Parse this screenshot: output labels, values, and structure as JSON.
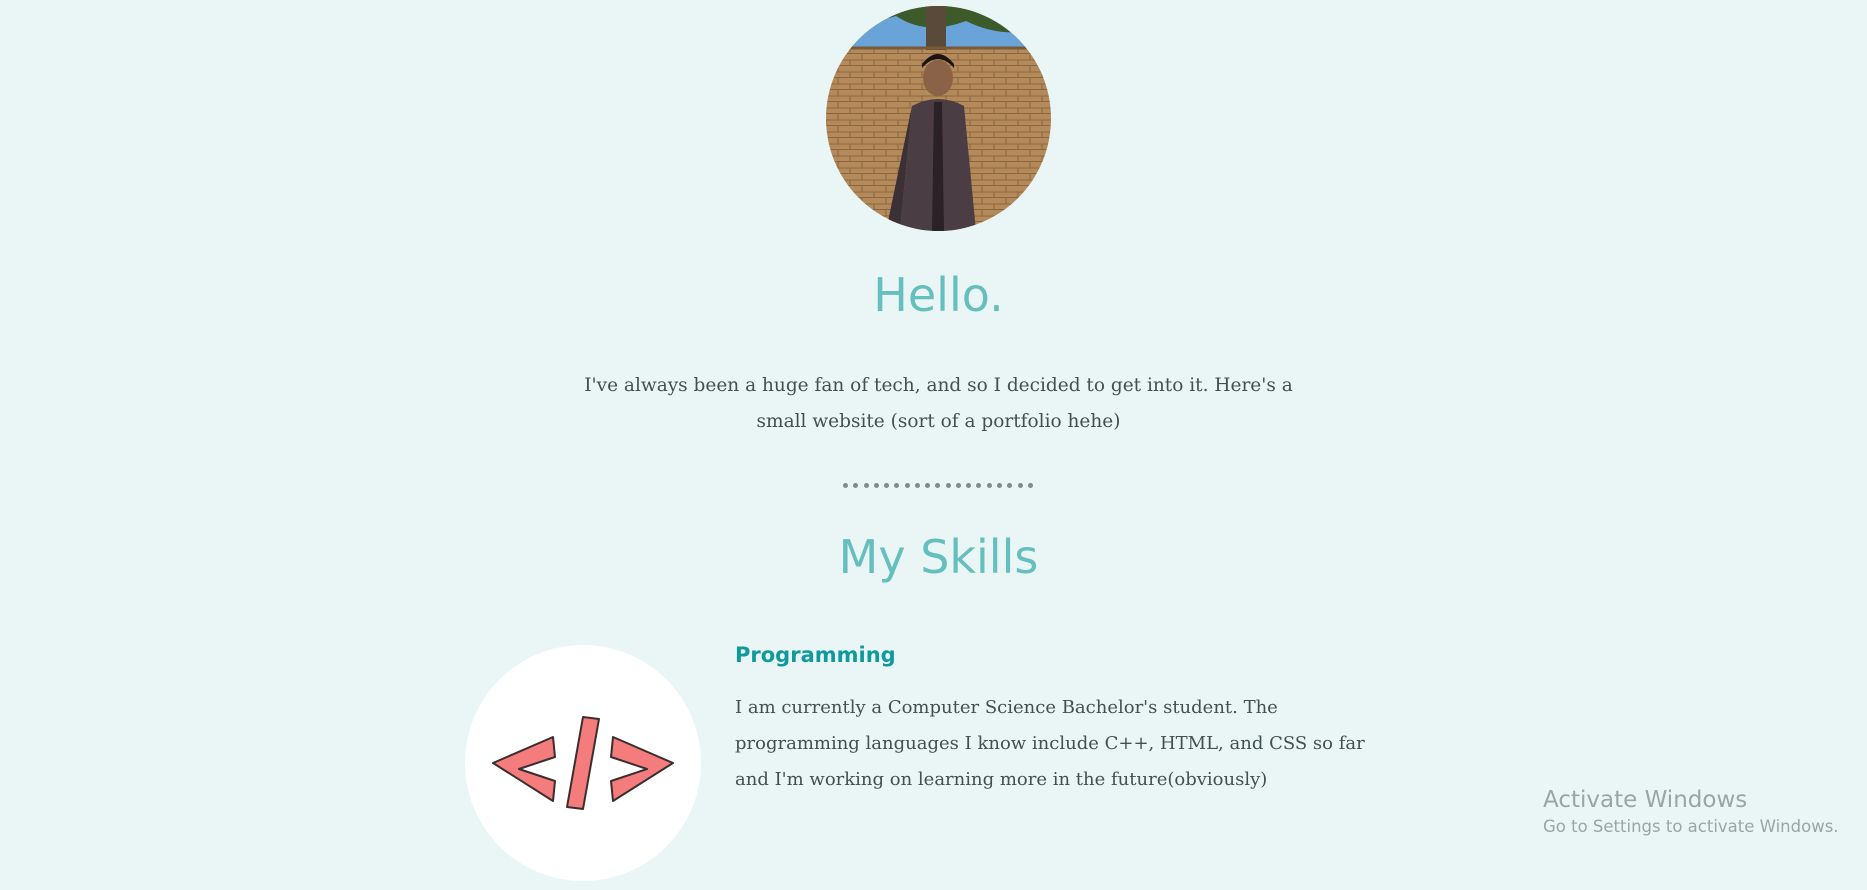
{
  "profile": {
    "image_alt": "profile photo"
  },
  "intro": {
    "greeting": "Hello.",
    "text": "I've always been a huge fan of tech, and so I decided to get into it. Here's a small website (sort of a portfolio hehe)"
  },
  "skills": {
    "title": "My Skills",
    "items": [
      {
        "heading": "Programming",
        "icon": "code-icon",
        "description": "I am currently a Computer Science Bachelor's student. The programming languages I know include C++, HTML, and CSS so far and I'm working on learning more in the future(obviously)"
      }
    ]
  },
  "os_overlay": {
    "title": "Activate Windows",
    "subtitle": "Go to Settings to activate Windows."
  },
  "colors": {
    "background": "#eaf6f6",
    "heading_accent": "#66bfbf",
    "skill_heading": "#11999e",
    "text": "#40514e",
    "code_icon": "#f47c7c"
  }
}
